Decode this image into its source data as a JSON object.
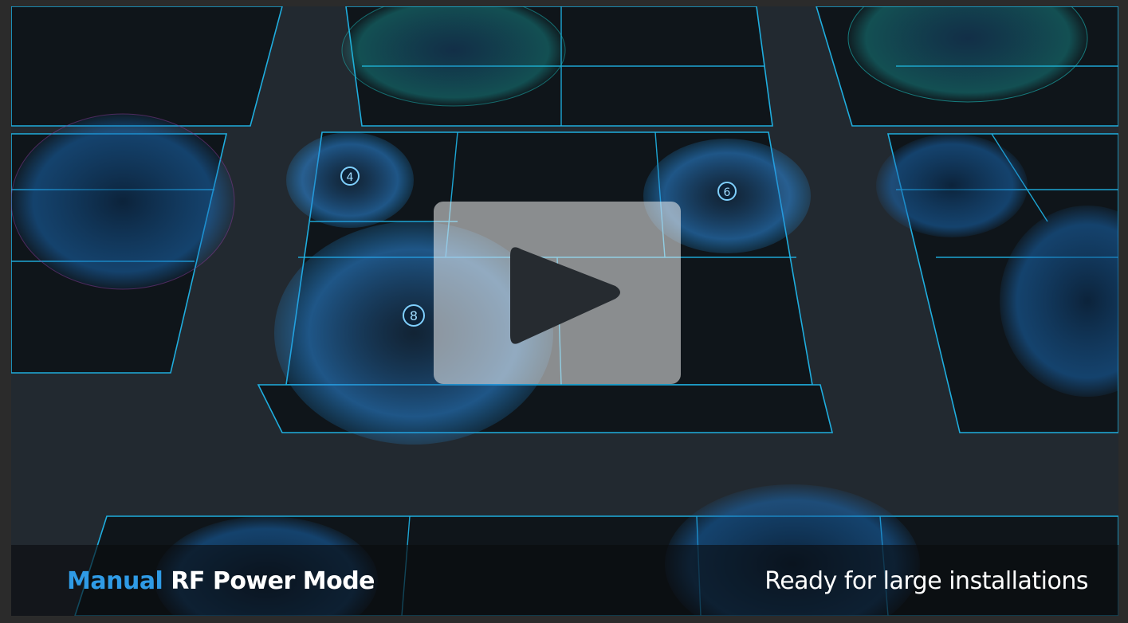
{
  "video": {
    "play_icon": "play-icon",
    "markers": [
      "4",
      "6",
      "8"
    ],
    "accent_color": "#1f8fe0",
    "caption": {
      "highlight": "Manual",
      "title_rest": "RF Power Mode",
      "tagline": "Ready for large installations"
    }
  }
}
